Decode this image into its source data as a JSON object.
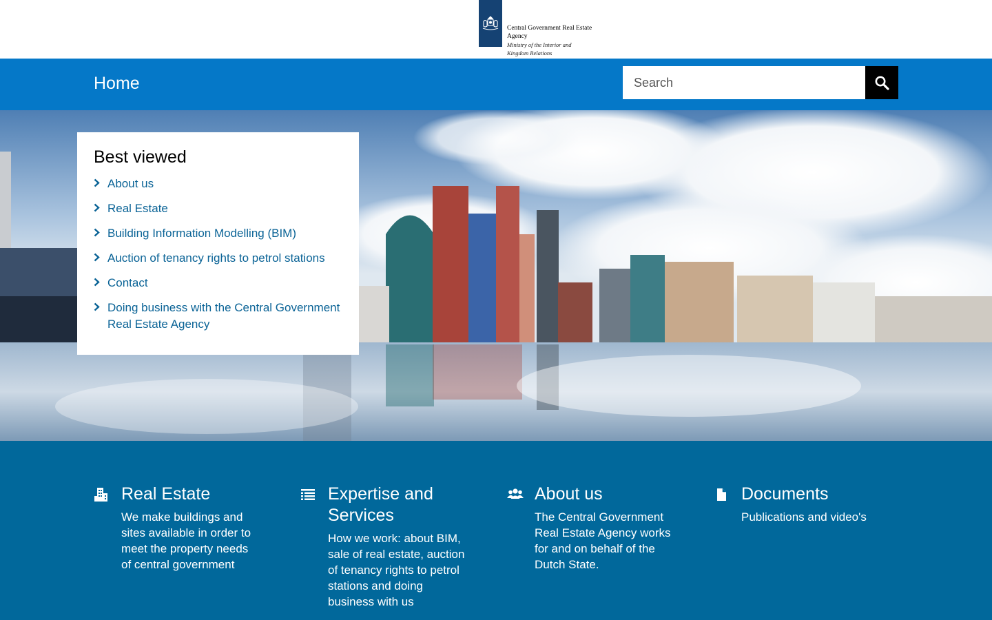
{
  "header": {
    "logo": {
      "line1": "Central Government Real Estate",
      "line2": "Agency",
      "line3": "Ministry of the Interior and",
      "line4": "Kingdom Relations"
    }
  },
  "nav": {
    "home_label": "Home",
    "search_placeholder": "Search"
  },
  "best_viewed": {
    "title": "Best viewed",
    "items": [
      {
        "label": "About us"
      },
      {
        "label": "Real Estate"
      },
      {
        "label": "Building Information Modelling (BIM)"
      },
      {
        "label": "Auction of tenancy rights to petrol stations"
      },
      {
        "label": "Contact"
      },
      {
        "label": "Doing business with the Central Government Real Estate Agency"
      }
    ]
  },
  "sections": [
    {
      "icon": "building-icon",
      "title": "Real Estate",
      "text": "We make buildings and sites available in order to meet the property needs of central government"
    },
    {
      "icon": "list-icon",
      "title": "Expertise and Services",
      "text": "How we work: about BIM, sale of real estate, auction of tenancy rights to petrol stations and doing business with us"
    },
    {
      "icon": "people-icon",
      "title": "About us",
      "text": "The Central Government Real Estate Agency works for and on behalf of the Dutch State."
    },
    {
      "icon": "document-icon",
      "title": "Documents",
      "text": "Publications and video's"
    }
  ],
  "colors": {
    "brand_dark": "#154273",
    "nav_blue": "#0578c8",
    "section_blue": "#01689b",
    "link_blue": "#0a6396"
  }
}
